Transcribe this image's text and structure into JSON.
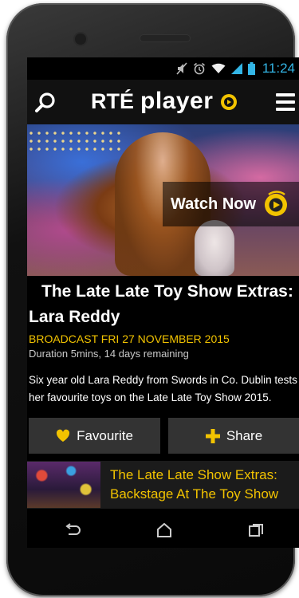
{
  "status_bar": {
    "time": "11:24",
    "icons": [
      "mute-icon",
      "alarm-icon",
      "wifi-icon",
      "signal-icon",
      "battery-icon"
    ],
    "accent_color": "#33b5e5"
  },
  "app_bar": {
    "brand_rte": "RTÉ",
    "brand_player": "player",
    "icons": [
      "search-icon",
      "player-logo-icon",
      "menu-icon"
    ]
  },
  "hero": {
    "watch_now_label": "Watch Now",
    "icon": "play-icon"
  },
  "program": {
    "title": "The Late Late Toy Show Extras: Lara Reddy",
    "broadcast": "BROADCAST FRI 27 NOVEMBER 2015",
    "duration": "Duration 5mins, 14 days remaining",
    "description": "Six year old Lara Reddy from Swords in Co. Dublin tests her favourite toys on the Late Late Toy Show 2015."
  },
  "actions": {
    "favourite_label": "Favourite",
    "favourite_icon": "heart-icon",
    "share_label": "Share",
    "share_icon": "plus-icon"
  },
  "related": {
    "title": "The Late Late Show Extras: Backstage At The Toy Show"
  },
  "nav_bar": {
    "icons": [
      "back-icon",
      "home-icon",
      "recents-icon"
    ]
  },
  "colors": {
    "brand_yellow": "#f2c300",
    "button_bg": "#333333",
    "app_bar_bg": "#111111"
  }
}
